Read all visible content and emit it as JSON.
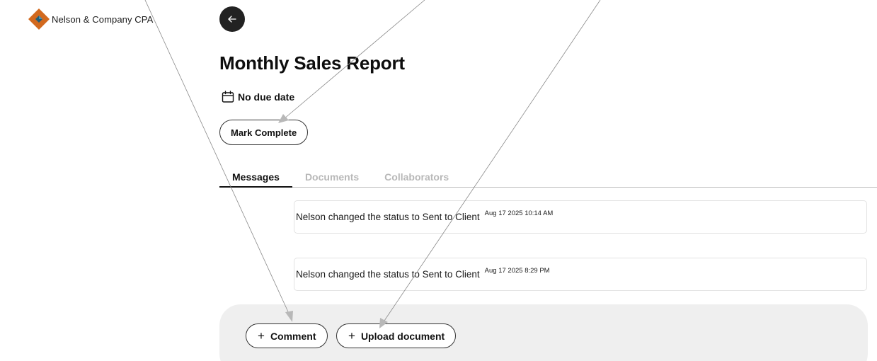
{
  "brand": {
    "name": "Nelson & Company CPA",
    "logo_icon": "diamond-logo-icon",
    "colors": {
      "outer": "#d2691e",
      "inner": "#1f5f7a"
    }
  },
  "header": {
    "back_icon": "arrow-left-icon"
  },
  "task": {
    "title": "Monthly Sales Report",
    "due_date_icon": "calendar-icon",
    "due_date": "No due date",
    "mark_complete_label": "Mark Complete"
  },
  "tabs": [
    {
      "label": "Messages",
      "active": true
    },
    {
      "label": "Documents",
      "active": false
    },
    {
      "label": "Collaborators",
      "active": false
    }
  ],
  "messages": [
    {
      "text": "Nelson changed the status to Sent to Client",
      "time": "Aug 17 2025 10:14 AM"
    },
    {
      "text": "Nelson changed the status to Sent to Client",
      "time": "Aug 17 2025 8:29 PM"
    }
  ],
  "actions": {
    "comment_label": "Comment",
    "upload_label": "Upload document",
    "plus_glyph": "+"
  }
}
